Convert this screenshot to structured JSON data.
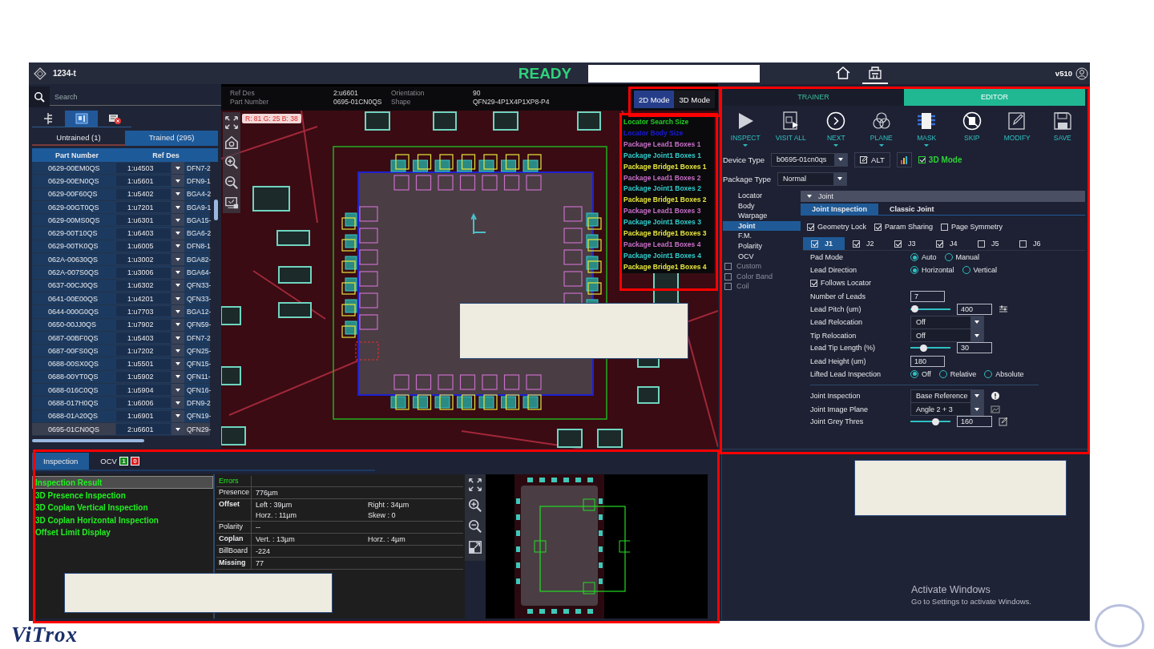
{
  "header": {
    "project": "1234-t",
    "status": "READY",
    "version": "v510",
    "nav": [
      {
        "kind": "home",
        "selected": false
      },
      {
        "kind": "machine",
        "selected": true
      }
    ]
  },
  "parts_panel": {
    "search_placeholder": "Search",
    "view_tabs": [
      {
        "kind": "tree",
        "selected": false
      },
      {
        "kind": "board",
        "selected": true
      },
      {
        "kind": "error",
        "selected": false
      }
    ],
    "tabs": [
      {
        "label": "Untrained (1)",
        "selected": false
      },
      {
        "label": "Trained (295)",
        "selected": true
      }
    ],
    "columns": [
      "Part Number",
      "Ref Des"
    ],
    "rows": [
      {
        "part_number": "0629-00EM0QS",
        "ref_des": "1:u4503",
        "column_3": "DFN7-2",
        "selected": false
      },
      {
        "part_number": "0629-00EN0QS",
        "ref_des": "1:u5601",
        "column_3": "DFN9-1",
        "selected": false
      },
      {
        "part_number": "0629-00F60QS",
        "ref_des": "1:u5402",
        "column_3": "BGA4-2",
        "selected": false
      },
      {
        "part_number": "0629-00GT0QS",
        "ref_des": "1:u7201",
        "column_3": "BGA9-1",
        "selected": false
      },
      {
        "part_number": "0629-00MS0QS",
        "ref_des": "1:u6301",
        "column_3": "BGA15-",
        "selected": false
      },
      {
        "part_number": "0629-00T10QS",
        "ref_des": "1:u6403",
        "column_3": "BGA6-2",
        "selected": false
      },
      {
        "part_number": "0629-00TK0QS",
        "ref_des": "1:u6005",
        "column_3": "DFN8-1",
        "selected": false
      },
      {
        "part_number": "062A-00630QS",
        "ref_des": "1:u3002",
        "column_3": "BGA82-",
        "selected": false
      },
      {
        "part_number": "062A-007S0QS",
        "ref_des": "1:u3006",
        "column_3": "BGA64-",
        "selected": false
      },
      {
        "part_number": "0637-00CJ0QS",
        "ref_des": "1:u6302",
        "column_3": "QFN33-",
        "selected": false
      },
      {
        "part_number": "0641-00E00QS",
        "ref_des": "1:u4201",
        "column_3": "QFN33-",
        "selected": false
      },
      {
        "part_number": "0644-000G0QS",
        "ref_des": "1:u7703",
        "column_3": "BGA12-",
        "selected": false
      },
      {
        "part_number": "0650-00JJ0QS",
        "ref_des": "1:u7902",
        "column_3": "QFN59-",
        "selected": false
      },
      {
        "part_number": "0687-00BF0QS",
        "ref_des": "1:u5403",
        "column_3": "DFN7-2",
        "selected": false
      },
      {
        "part_number": "0687-00FS0QS",
        "ref_des": "1:u7202",
        "column_3": "QFN25-",
        "selected": false
      },
      {
        "part_number": "0688-00SX0QS",
        "ref_des": "1:u5501",
        "column_3": "QFN15-",
        "selected": false
      },
      {
        "part_number": "0688-00YT0QS",
        "ref_des": "1:u5902",
        "column_3": "QFN11-",
        "selected": false
      },
      {
        "part_number": "0688-016C0QS",
        "ref_des": "1:u5904",
        "column_3": "QFN16-",
        "selected": false
      },
      {
        "part_number": "0688-017H0QS",
        "ref_des": "1:u6006",
        "column_3": "DFN9-2",
        "selected": false
      },
      {
        "part_number": "0688-01A20QS",
        "ref_des": "1:u6901",
        "column_3": "QFN19-",
        "selected": false
      },
      {
        "part_number": "0695-01CN0QS",
        "ref_des": "2:u6601",
        "column_3": "QFN29-",
        "selected": true
      }
    ]
  },
  "image_view": {
    "info": [
      {
        "label": "Ref Des",
        "value": "2:u6601"
      },
      {
        "label": "Part Number",
        "value": "0695-01CN0QS"
      },
      {
        "label": "Orientation",
        "value": "90"
      },
      {
        "label": "Shape",
        "value": "QFN29-4P1X4P1XP8-P4"
      }
    ],
    "modes": [
      {
        "label": "2D Mode",
        "selected": true
      },
      {
        "label": "3D Mode",
        "selected": false
      }
    ],
    "pixel_readout": "R: 81 G: 25 B: 38",
    "legend": [
      {
        "label": "Locator Search Size",
        "color": "#22cc22"
      },
      {
        "label": "Locator Body Size",
        "color": "#1a1ad6"
      },
      {
        "label": "Package Lead1 Boxes 1",
        "color": "#c86ec8"
      },
      {
        "label": "Package Joint1 Boxes 1",
        "color": "#33cccc"
      },
      {
        "label": "Package Bridge1 Boxes 1",
        "color": "#e6e63c"
      },
      {
        "label": "Package Lead1 Boxes 2",
        "color": "#c86ec8"
      },
      {
        "label": "Package Joint1 Boxes 2",
        "color": "#33cccc"
      },
      {
        "label": "Package Bridge1 Boxes 2",
        "color": "#e6e63c"
      },
      {
        "label": "Package Lead1 Boxes 3",
        "color": "#c86ec8"
      },
      {
        "label": "Package Joint1 Boxes 3",
        "color": "#33cccc"
      },
      {
        "label": "Package Bridge1 Boxes 3",
        "color": "#e6e63c"
      },
      {
        "label": "Package Lead1 Boxes 4",
        "color": "#c86ec8"
      },
      {
        "label": "Package Joint1 Boxes 4",
        "color": "#33cccc"
      },
      {
        "label": "Package Bridge1 Boxes 4",
        "color": "#e6e63c"
      }
    ]
  },
  "editor": {
    "mode_tabs": [
      {
        "label": "TRAINER",
        "selected": false
      },
      {
        "label": "EDITOR",
        "selected": true
      }
    ],
    "toolbar": [
      {
        "label": "INSPECT",
        "kind": "play",
        "has_menu": true
      },
      {
        "label": "VISIT ALL",
        "kind": "visit",
        "has_menu": false
      },
      {
        "label": "NEXT",
        "kind": "next",
        "has_menu": true
      },
      {
        "label": "PLANE",
        "kind": "plane",
        "has_menu": true
      },
      {
        "label": "MASK",
        "kind": "mask",
        "has_menu": true
      },
      {
        "label": "SKIP",
        "kind": "skip",
        "has_menu": false
      },
      {
        "label": "MODIFY",
        "kind": "modify",
        "has_menu": false
      },
      {
        "label": "SAVE",
        "kind": "save",
        "has_menu": false
      }
    ],
    "device_type": {
      "label": "Device Type",
      "value": "b0695-01cn0qs"
    },
    "alt_button": "ALT",
    "mode_3d": {
      "label": "3D Mode",
      "checked": true
    },
    "package_type": {
      "label": "Package Type",
      "value": "Normal"
    },
    "categories": [
      {
        "label": "Locator",
        "kind": "item",
        "selected": false
      },
      {
        "label": "Body",
        "kind": "item",
        "selected": false
      },
      {
        "label": "Warpage",
        "kind": "item",
        "selected": false
      },
      {
        "label": "Joint",
        "kind": "item",
        "selected": true
      },
      {
        "label": "F.M.",
        "kind": "item",
        "selected": false
      },
      {
        "label": "Polarity",
        "kind": "item",
        "selected": false
      },
      {
        "label": "OCV",
        "kind": "item",
        "selected": false
      },
      {
        "label": "Custom",
        "kind": "checkbox",
        "checked": false
      },
      {
        "label": "Color Band",
        "kind": "checkbox",
        "checked": false
      },
      {
        "label": "Coil",
        "kind": "checkbox",
        "checked": false
      }
    ],
    "section": {
      "title": "Joint",
      "expanded": true
    },
    "sub_tabs": [
      {
        "label": "Joint Inspection",
        "selected": true
      },
      {
        "label": "Classic Joint",
        "selected": false
      }
    ],
    "options": [
      {
        "label": "Geometry Lock",
        "checked": true
      },
      {
        "label": "Param Sharing",
        "checked": true
      },
      {
        "label": "Page Symmetry",
        "checked": false
      }
    ],
    "joints": [
      {
        "label": "J1",
        "checked": true,
        "selected": true
      },
      {
        "label": "J2",
        "checked": true,
        "selected": false
      },
      {
        "label": "J3",
        "checked": true,
        "selected": false
      },
      {
        "label": "J4",
        "checked": true,
        "selected": false
      },
      {
        "label": "J5",
        "checked": false,
        "selected": false
      },
      {
        "label": "J6",
        "checked": false,
        "selected": false
      }
    ],
    "params": [
      {
        "kind": "radio",
        "label": "Pad Mode",
        "options": [
          {
            "label": "Auto",
            "selected": true
          },
          {
            "label": "Manual",
            "selected": false
          }
        ]
      },
      {
        "kind": "radio",
        "label": "Lead Direction",
        "options": [
          {
            "label": "Horizontal",
            "selected": true
          },
          {
            "label": "Vertical",
            "selected": false
          }
        ]
      },
      {
        "kind": "checkbox",
        "label": "Follows Locator",
        "checked": true
      },
      {
        "kind": "text",
        "label": "Number of Leads",
        "value": "7"
      },
      {
        "kind": "slider",
        "label": "Lead Pitch (um)",
        "level": 0.1,
        "value": "400"
      },
      {
        "kind": "select",
        "label": "Lead Relocation",
        "value": "Off"
      },
      {
        "kind": "select",
        "label": "Tip Relocation",
        "value": "Off"
      },
      {
        "kind": "slider",
        "label": "Lead Tip Length (%)",
        "level": 0.32,
        "value": "30"
      },
      {
        "kind": "text",
        "label": "Lead Height (um)",
        "value": "180"
      },
      {
        "kind": "radio",
        "label": "Lifted Lead Inspection",
        "options": [
          {
            "label": "Off",
            "selected": true
          },
          {
            "label": "Relative",
            "selected": false
          },
          {
            "label": "Absolute",
            "selected": false
          }
        ]
      }
    ],
    "joint_params": [
      {
        "kind": "select",
        "label": "Joint Inspection",
        "value": "Base Reference"
      },
      {
        "kind": "select",
        "label": "Joint Image Plane",
        "value": "Angle 2 + 3"
      },
      {
        "kind": "slider",
        "label": "Joint Grey Thres",
        "level": 0.62,
        "value": "160"
      }
    ]
  },
  "results": {
    "tabs": [
      {
        "label": "Inspection",
        "selected": true
      },
      {
        "label": "OCV",
        "selected": false,
        "pass_count": "1",
        "fail_count": "0"
      }
    ],
    "items": [
      {
        "label": "Inspection Result",
        "selected": true
      },
      {
        "label": "3D Presence Inspection",
        "selected": false
      },
      {
        "label": "3D Coplan Vertical Inspection",
        "selected": false
      },
      {
        "label": "3D Coplan Horizontal Inspection",
        "selected": false
      },
      {
        "label": "Offset Limit Display",
        "selected": false
      }
    ],
    "errors_title": "Errors",
    "error_rows": [
      {
        "label": "Presence",
        "emphasized": false,
        "cells": [
          "776µm"
        ]
      },
      {
        "label": "Offset",
        "emphasized": true,
        "cells": [
          "Left : 39µm",
          "Right : 34µm",
          "Horz. : 11µm",
          "Skew : 0"
        ]
      },
      {
        "label": "Polarity",
        "emphasized": false,
        "cells": [
          "--"
        ]
      },
      {
        "label": "Coplan",
        "emphasized": true,
        "cells": [
          "Vert. : 13µm",
          "Horz. : 4µm"
        ]
      },
      {
        "label": "BillBoard",
        "emphasized": false,
        "cells": [
          "-224"
        ]
      },
      {
        "label": "Missing",
        "emphasized": true,
        "cells": [
          "77"
        ]
      }
    ]
  },
  "activation_notice": {
    "title": "Activate Windows",
    "text": "Go to Settings to activate Windows."
  },
  "slide": {
    "logo": "ViTrox"
  }
}
